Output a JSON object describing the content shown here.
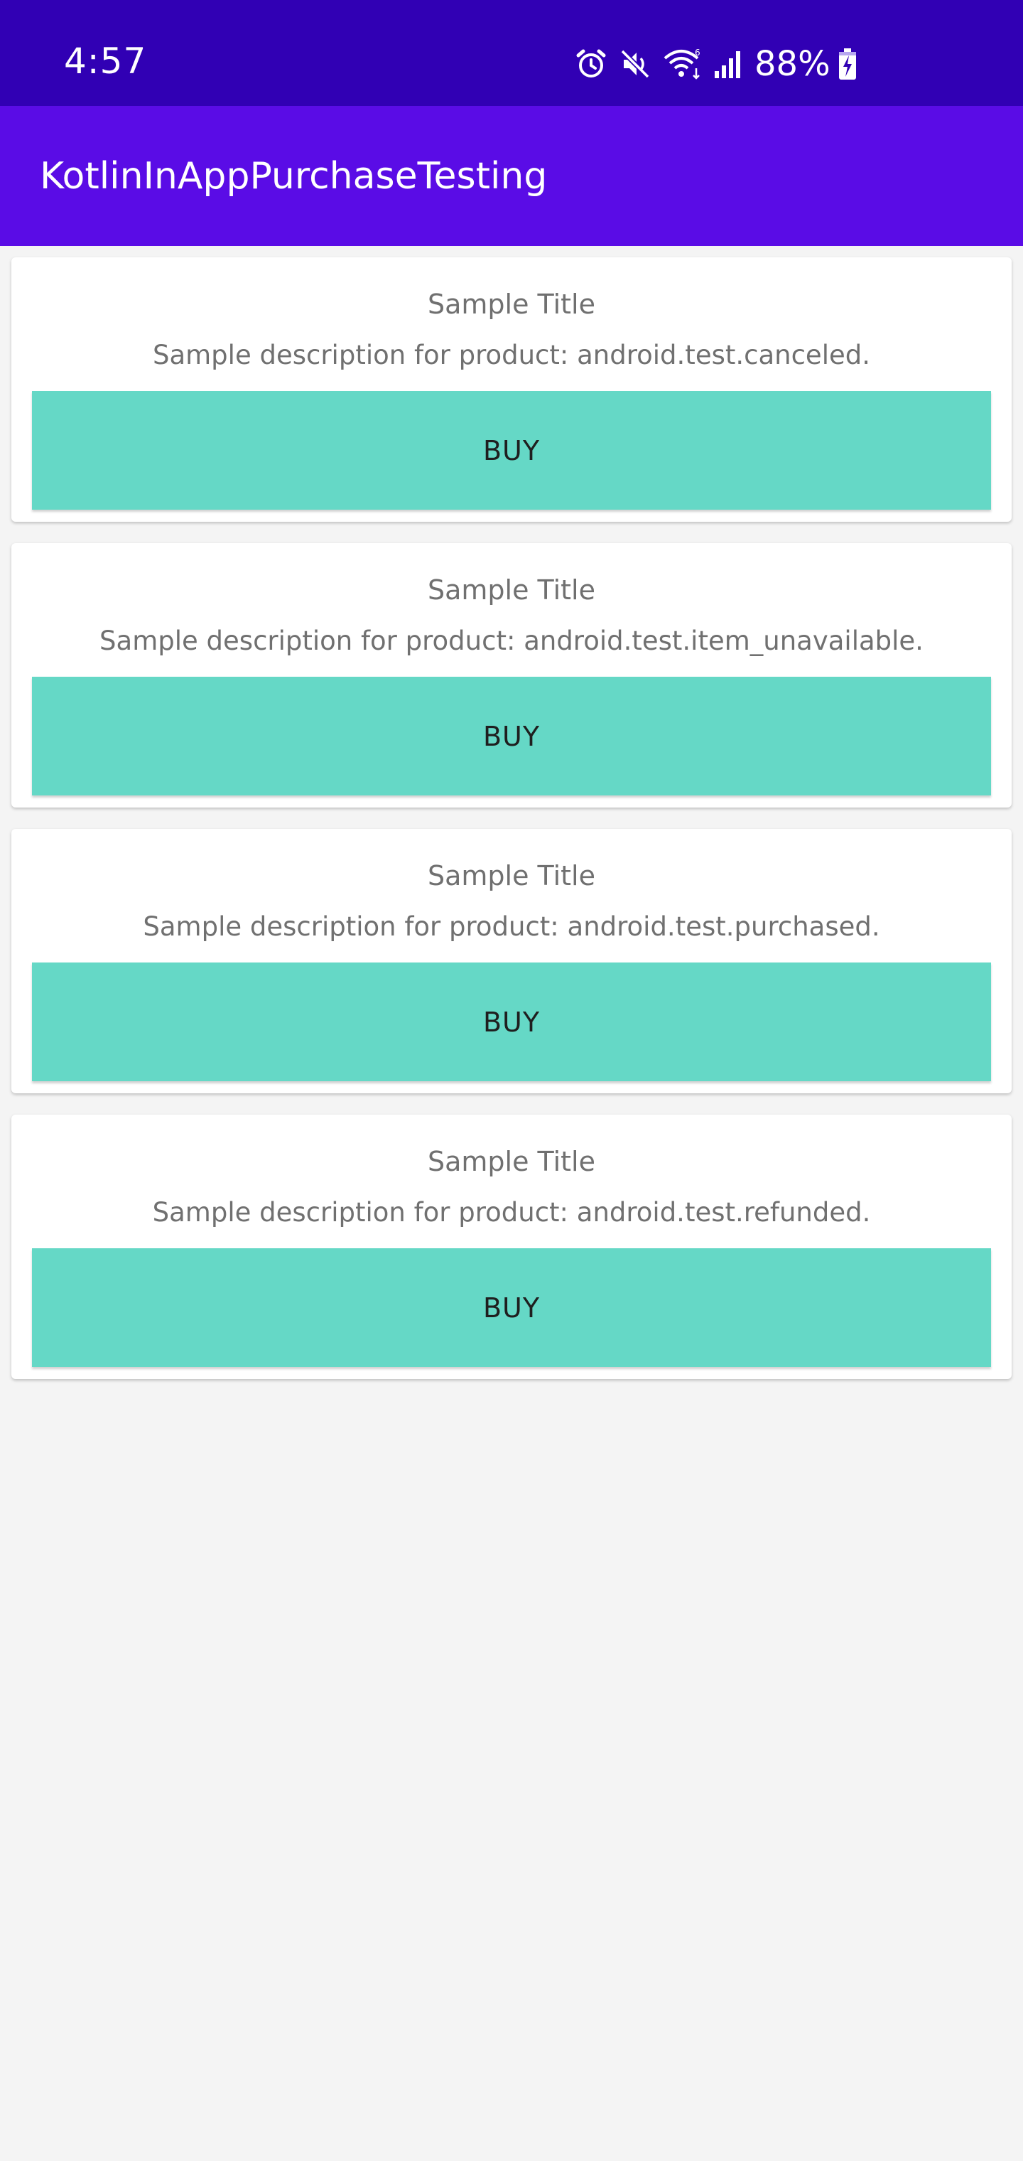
{
  "status_bar": {
    "time": "4:57",
    "battery_percent": "88%",
    "icons": [
      "alarm-icon",
      "mute-icon",
      "wifi-icon",
      "signal-icon",
      "battery-charging-icon"
    ],
    "background_color": "#3100b4"
  },
  "app_bar": {
    "title": "KotlinInAppPurchaseTesting",
    "background_color": "#5a0ce6"
  },
  "products": [
    {
      "title": "Sample Title",
      "description": "Sample description for product: android.test.canceled.",
      "button_label": "BUY"
    },
    {
      "title": "Sample Title",
      "description": "Sample description for product: android.test.item_unavailable.",
      "button_label": "BUY"
    },
    {
      "title": "Sample Title",
      "description": "Sample description for product: android.test.purchased.",
      "button_label": "BUY"
    },
    {
      "title": "Sample Title",
      "description": "Sample description for product: android.test.refunded.",
      "button_label": "BUY"
    }
  ],
  "colors": {
    "button": "#65d8c6",
    "page_background": "#f4f4f4"
  }
}
